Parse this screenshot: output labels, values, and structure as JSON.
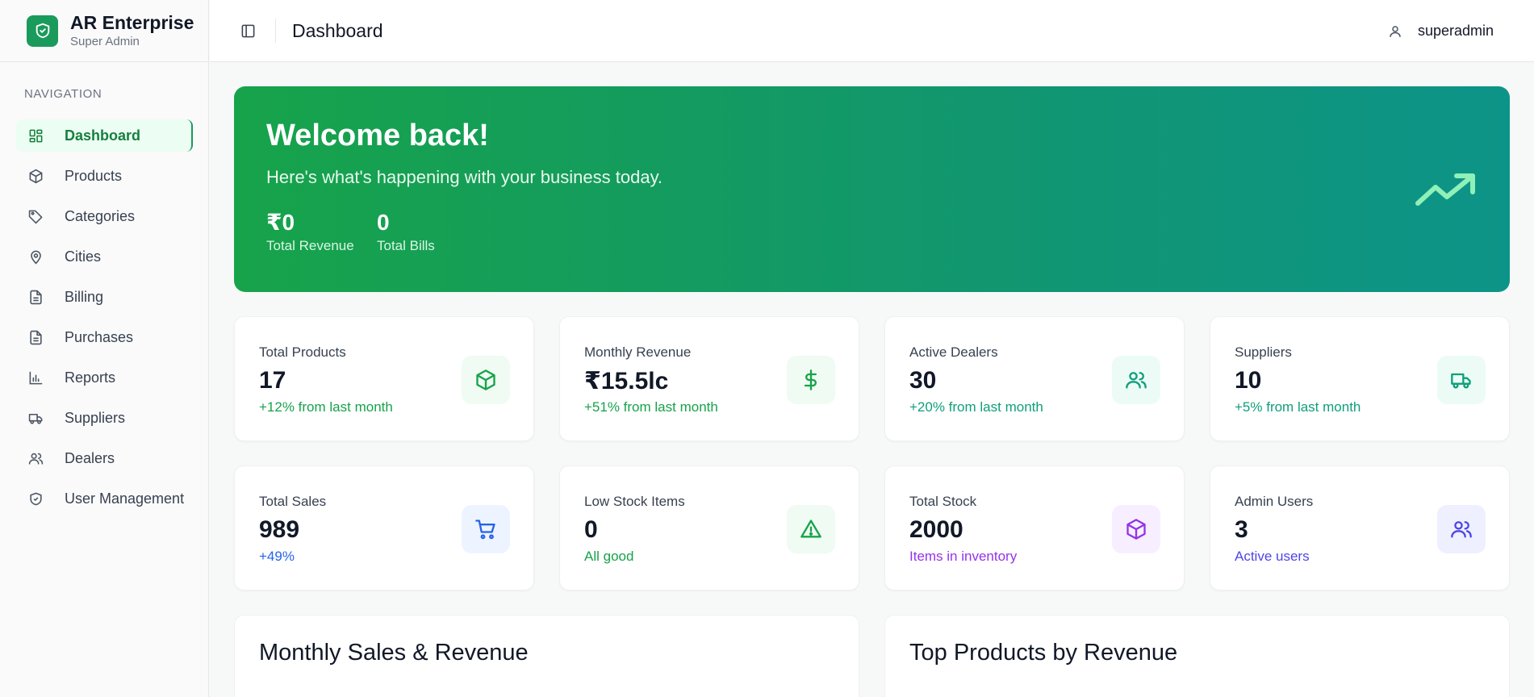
{
  "brand": {
    "name": "AR Enterprise",
    "role": "Super Admin",
    "logo_icon": "shield-check-icon",
    "color": "#1a9b5b"
  },
  "sidebar": {
    "heading": "NAVIGATION",
    "items": [
      {
        "label": "Dashboard",
        "icon": "dashboard-grid-icon",
        "active": true
      },
      {
        "label": "Products",
        "icon": "box-icon"
      },
      {
        "label": "Categories",
        "icon": "tag-icon"
      },
      {
        "label": "Cities",
        "icon": "map-pin-icon"
      },
      {
        "label": "Billing",
        "icon": "file-text-icon"
      },
      {
        "label": "Purchases",
        "icon": "file-text-icon"
      },
      {
        "label": "Reports",
        "icon": "bar-chart-icon"
      },
      {
        "label": "Suppliers",
        "icon": "truck-icon"
      },
      {
        "label": "Dealers",
        "icon": "users-icon"
      },
      {
        "label": "User Management",
        "icon": "shield-check-icon"
      }
    ]
  },
  "header": {
    "title": "Dashboard",
    "toggle_icon": "sidebar-toggle-icon",
    "user": "superadmin",
    "user_icon": "user-icon"
  },
  "hero": {
    "title": "Welcome back!",
    "subtitle": "Here's what's happening with your business today.",
    "stats": [
      {
        "value": "₹0",
        "label": "Total Revenue"
      },
      {
        "value": "0",
        "label": "Total Bills"
      }
    ],
    "icon": "trending-up-icon",
    "gradient": [
      "#17a34a",
      "#0d9488"
    ]
  },
  "cards": [
    {
      "title": "Total Products",
      "value": "17",
      "sub": "+12% from last month",
      "icon": "box-icon",
      "color": "#16a34a",
      "bg": "#effbf3"
    },
    {
      "title": "Monthly Revenue",
      "value": "₹15.5lc",
      "sub": "+51% from last month",
      "icon": "dollar-icon",
      "color": "#16a34a",
      "bg": "#effbf3"
    },
    {
      "title": "Active Dealers",
      "value": "30",
      "sub": "+20% from last month",
      "icon": "users-icon",
      "color": "#0f9f7a",
      "bg": "#ecfbf6"
    },
    {
      "title": "Suppliers",
      "value": "10",
      "sub": "+5% from last month",
      "icon": "truck-icon",
      "color": "#0f9f7a",
      "bg": "#ecfbf6"
    },
    {
      "title": "Total Sales",
      "value": "989",
      "sub": "+49%",
      "icon": "cart-icon",
      "color": "#2563eb",
      "bg": "#eef4ff"
    },
    {
      "title": "Low Stock Items",
      "value": "0",
      "sub": "All good",
      "icon": "alert-triangle-icon",
      "color": "#16a34a",
      "bg": "#effbf3"
    },
    {
      "title": "Total Stock",
      "value": "2000",
      "sub": "Items in inventory",
      "icon": "box-icon",
      "color": "#9333ea",
      "bg": "#f7efff"
    },
    {
      "title": "Admin Users",
      "value": "3",
      "sub": "Active users",
      "icon": "users-icon",
      "color": "#4f46e5",
      "bg": "#eef0ff"
    }
  ],
  "panels": [
    {
      "title": "Monthly Sales & Revenue"
    },
    {
      "title": "Top Products by Revenue"
    }
  ]
}
